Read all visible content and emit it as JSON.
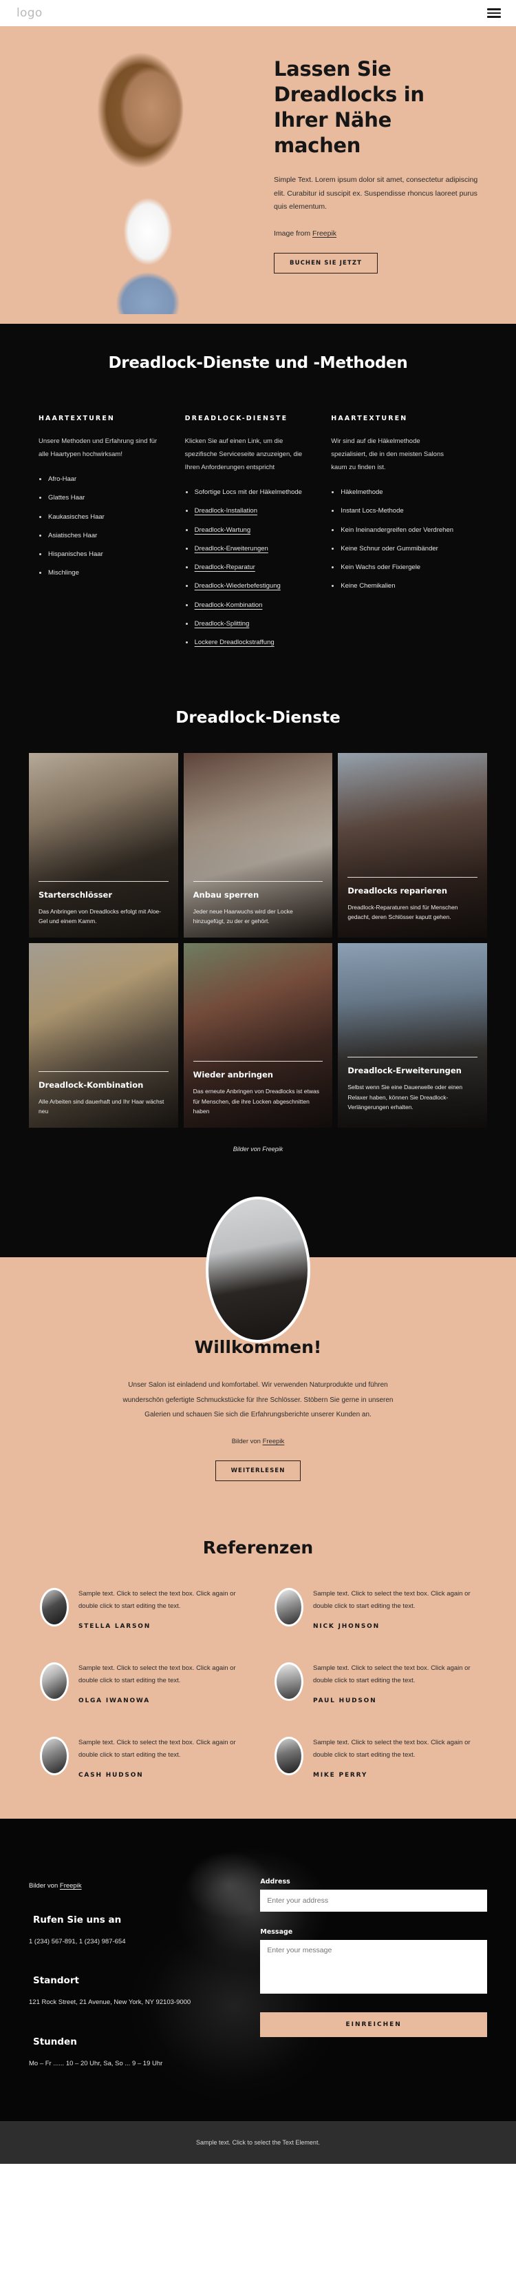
{
  "header": {
    "logo": "logo",
    "menu_icon": "hamburger-menu-icon"
  },
  "hero": {
    "title": "Lassen Sie Dreadlocks in Ihrer Nähe machen",
    "paragraph": "Simple Text. Lorem ipsum dolor sit amet, consectetur adipiscing elit. Curabitur id suscipit ex. Suspendisse rhoncus laoreet purus quis elementum.",
    "credit_prefix": "Image from ",
    "credit_link": "Freepik",
    "cta": "BUCHEN SIE JETZT"
  },
  "methods": {
    "title": "Dreadlock-Dienste und -Methoden",
    "columns": [
      {
        "heading": "HAARTEXTUREN",
        "intro": "Unsere Methoden und Erfahrung sind für alle Haartypen hochwirksam!",
        "items": [
          {
            "label": "Afro-Haar",
            "link": false
          },
          {
            "label": "Glattes Haar",
            "link": false
          },
          {
            "label": "Kaukasisches Haar",
            "link": false
          },
          {
            "label": "Asiatisches Haar",
            "link": false
          },
          {
            "label": "Hispanisches Haar",
            "link": false
          },
          {
            "label": "Mischlinge",
            "link": false
          }
        ]
      },
      {
        "heading": "DREADLOCK-DIENSTE",
        "intro": "Klicken Sie auf einen Link, um die spezifische Serviceseite anzuzeigen, die Ihren Anforderungen entspricht",
        "items": [
          {
            "label": "Sofortige Locs mit der Häkelmethode",
            "link": false
          },
          {
            "label": "Dreadlock-Installation",
            "link": true
          },
          {
            "label": "Dreadlock-Wartung",
            "link": true
          },
          {
            "label": "Dreadlock-Erweiterungen",
            "link": true
          },
          {
            "label": "Dreadlock-Reparatur",
            "link": true
          },
          {
            "label": "Dreadlock-Wiederbefestigung",
            "link": true
          },
          {
            "label": "Dreadlock-Kombination",
            "link": true
          },
          {
            "label": "Dreadlock-Splitting",
            "link": true
          },
          {
            "label": "Lockere Dreadlockstraffung",
            "link": true
          }
        ]
      },
      {
        "heading": "HAARTEXTUREN",
        "intro": "Wir sind auf die Häkelmethode spezialisiert, die in den meisten Salons kaum zu finden ist.",
        "items": [
          {
            "label": "Häkelmethode",
            "link": false
          },
          {
            "label": "Instant Locs-Methode",
            "link": false
          },
          {
            "label": "Kein Ineinandergreifen oder Verdrehen",
            "link": false
          },
          {
            "label": "Keine Schnur oder Gummibänder",
            "link": false
          },
          {
            "label": "Kein Wachs oder Fixiergele",
            "link": false
          },
          {
            "label": "Keine Chemikalien",
            "link": false
          }
        ]
      }
    ]
  },
  "gallery": {
    "title": "Dreadlock-Dienste",
    "credit": "Bilder von Freepik",
    "cards": [
      {
        "title": "Starterschlösser",
        "text": "Das Anbringen von Dreadlocks erfolgt mit Aloe-Gel und einem Kamm."
      },
      {
        "title": "Anbau sperren",
        "text": "Jeder neue Haarwuchs wird der Locke hinzugefügt, zu der er gehört."
      },
      {
        "title": "Dreadlocks reparieren",
        "text": "Dreadlock-Reparaturen sind für Menschen gedacht, deren Schlösser kaputt gehen."
      },
      {
        "title": "Dreadlock-Kombination",
        "text": "Alle Arbeiten sind dauerhaft und Ihr Haar wächst neu"
      },
      {
        "title": "Wieder anbringen",
        "text": "Das erneute Anbringen von Dreadlocks ist etwas für Menschen, die ihre Locken abgeschnitten haben"
      },
      {
        "title": "Dreadlock-Erweiterungen",
        "text": "Selbst wenn Sie eine Dauerwelle oder einen Relaxer haben, können Sie Dreadlock-Verlängerungen erhalten."
      }
    ]
  },
  "welcome": {
    "title": "Willkommen!",
    "body": "Unser Salon ist einladend und komfortabel. Wir verwenden Naturprodukte und führen wunderschön gefertigte Schmuckstücke für Ihre Schlösser. Stöbern Sie gerne in unseren Galerien und schauen Sie sich die Erfahrungsberichte unserer Kunden an.",
    "credit_prefix": "Bilder von ",
    "credit_link": "Freepik",
    "cta": "WEITERLESEN"
  },
  "testimonials": {
    "title": "Referenzen",
    "items": [
      {
        "text": "Sample text. Click to select the text box. Click again or double click to start editing the text.",
        "name": "STELLA LARSON"
      },
      {
        "text": "Sample text. Click to select the text box. Click again or double click to start editing the text.",
        "name": "NICK JHONSON"
      },
      {
        "text": "Sample text. Click to select the text box. Click again or double click to start editing the text.",
        "name": "OLGA IWANOWA"
      },
      {
        "text": "Sample text. Click to select the text box. Click again or double click to start editing the text.",
        "name": "PAUL HUDSON"
      },
      {
        "text": "Sample text. Click to select the text box. Click again or double click to start editing the text.",
        "name": "CASH HUDSON"
      },
      {
        "text": "Sample text. Click to select the text box. Click again or double click to start editing the text.",
        "name": "MIKE PERRY"
      }
    ]
  },
  "contact": {
    "credit_prefix": "Bilder von ",
    "credit_link": "Freepik",
    "phone_heading": "Rufen Sie uns an",
    "phone_value": "1 (234) 567-891, 1 (234) 987-654",
    "location_heading": "Standort",
    "location_value": "121 Rock Street, 21 Avenue, New York, NY 92103-9000",
    "hours_heading": "Stunden",
    "hours_value": "Mo – Fr ...... 10 – 20 Uhr, Sa, So ... 9 – 19 Uhr",
    "address_label": "Address",
    "address_placeholder": "Enter your address",
    "message_label": "Message",
    "message_placeholder": "Enter your message",
    "submit": "EINREICHEN"
  },
  "footer": {
    "text": "Sample text. Click to select the Text Element."
  },
  "colors": {
    "peach": "#e8bb9f",
    "dark": "#0a0a0a",
    "footer_bar": "#2e2e2e"
  }
}
